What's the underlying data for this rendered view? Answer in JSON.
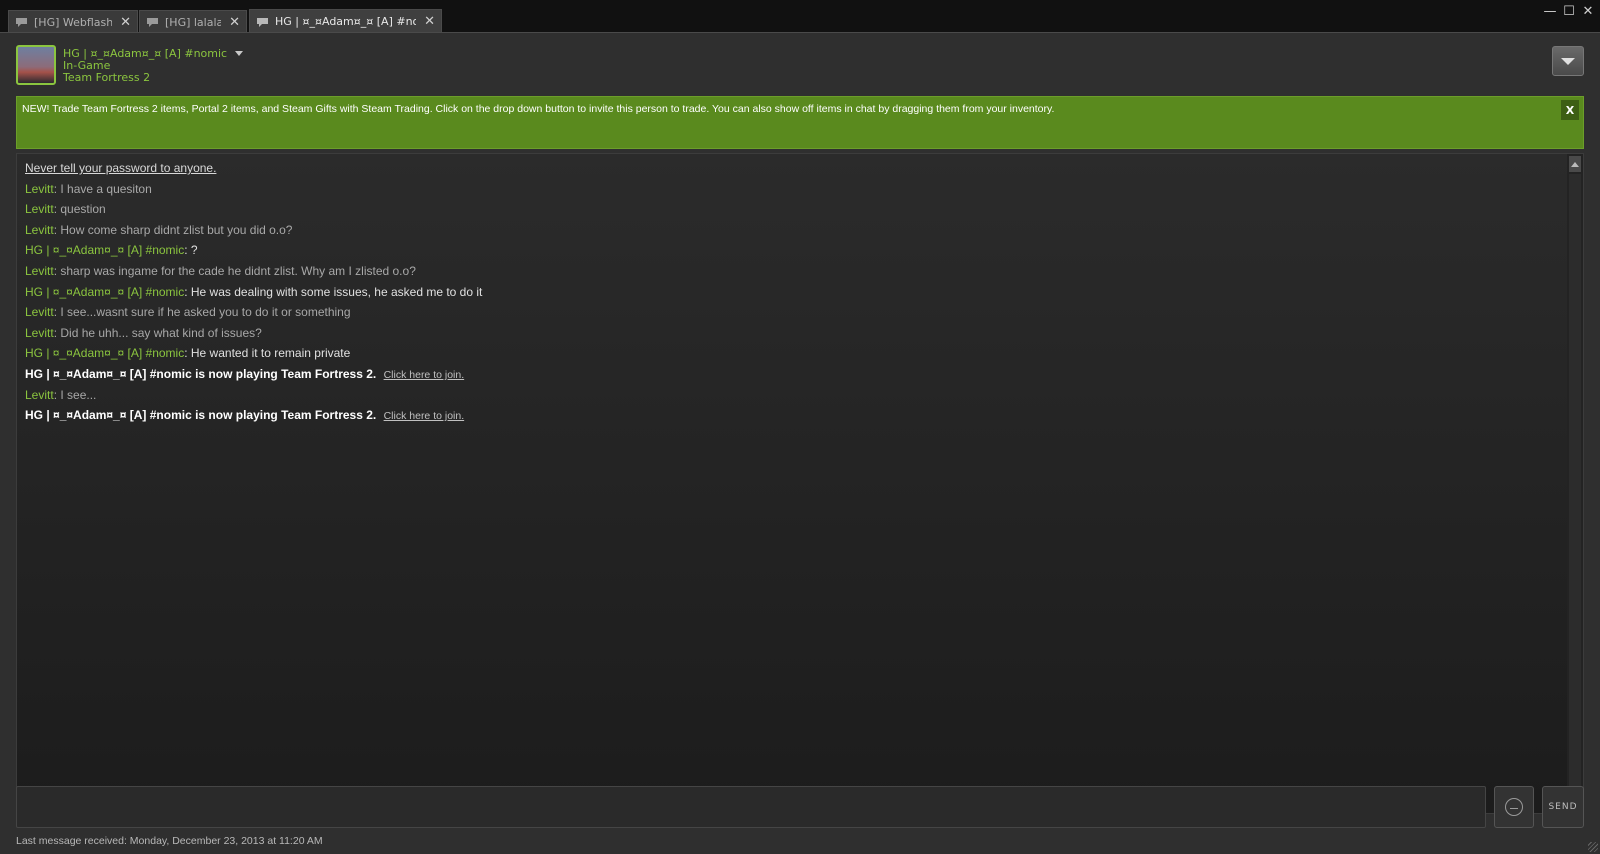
{
  "tabs": [
    {
      "label": "[HG] Webflashing",
      "active": false
    },
    {
      "label": "[HG] lalalalala",
      "active": false
    },
    {
      "label": "HG | ¤_¤Adam¤_¤ [A] #nomic",
      "active": true
    }
  ],
  "window_controls": {
    "minimize": "—",
    "maximize": "☐",
    "close": "✕"
  },
  "friend": {
    "name": "HG | ¤_¤Adam¤_¤ [A] #nomic",
    "status": "In-Game",
    "game": "Team Fortress 2"
  },
  "notice": {
    "text": "NEW! Trade Team Fortress 2 items, Portal 2 items, and Steam Gifts with Steam Trading. Click on the drop down button to invite this person to trade. You can also show off items in chat by dragging them from your inventory.",
    "close_label": "X"
  },
  "chat": {
    "warning": "Never tell your password to anyone.",
    "messages": [
      {
        "sender": "Levitt",
        "text": "I have a quesiton"
      },
      {
        "sender": "Levitt",
        "text": "question"
      },
      {
        "sender": "Levitt",
        "text": "How come sharp didnt zlist but you did o.o?"
      },
      {
        "sender": "HG | ¤_¤Adam¤_¤ [A] #nomic",
        "text": "?"
      },
      {
        "sender": "Levitt",
        "text": "sharp was ingame for the cade he didnt zlist. Why am I zlisted o.o?"
      },
      {
        "sender": "HG | ¤_¤Adam¤_¤ [A] #nomic",
        "text": "He was dealing with some issues, he asked me to do it"
      },
      {
        "sender": "Levitt",
        "text": "I see...wasnt sure if he asked you to do it or something"
      },
      {
        "sender": "Levitt",
        "text": "Did he uhh... say what kind of issues?"
      },
      {
        "sender": "HG | ¤_¤Adam¤_¤ [A] #nomic",
        "text": "He wanted it to remain private"
      }
    ],
    "system1": "HG | ¤_¤Adam¤_¤ [A] #nomic is now playing Team Fortress 2.",
    "join_link": "Click here to join.",
    "last_msg": {
      "sender": "Levitt",
      "text": "I see..."
    },
    "system2": "HG | ¤_¤Adam¤_¤ [A] #nomic is now playing Team Fortress 2."
  },
  "input": {
    "value": "",
    "send_label": "SEND"
  },
  "status_bar": "Last message received: Monday, December 23, 2013 at 11:20 AM",
  "colors": {
    "accent": "#8bc53f",
    "notice_bg": "#5a8a1e"
  }
}
